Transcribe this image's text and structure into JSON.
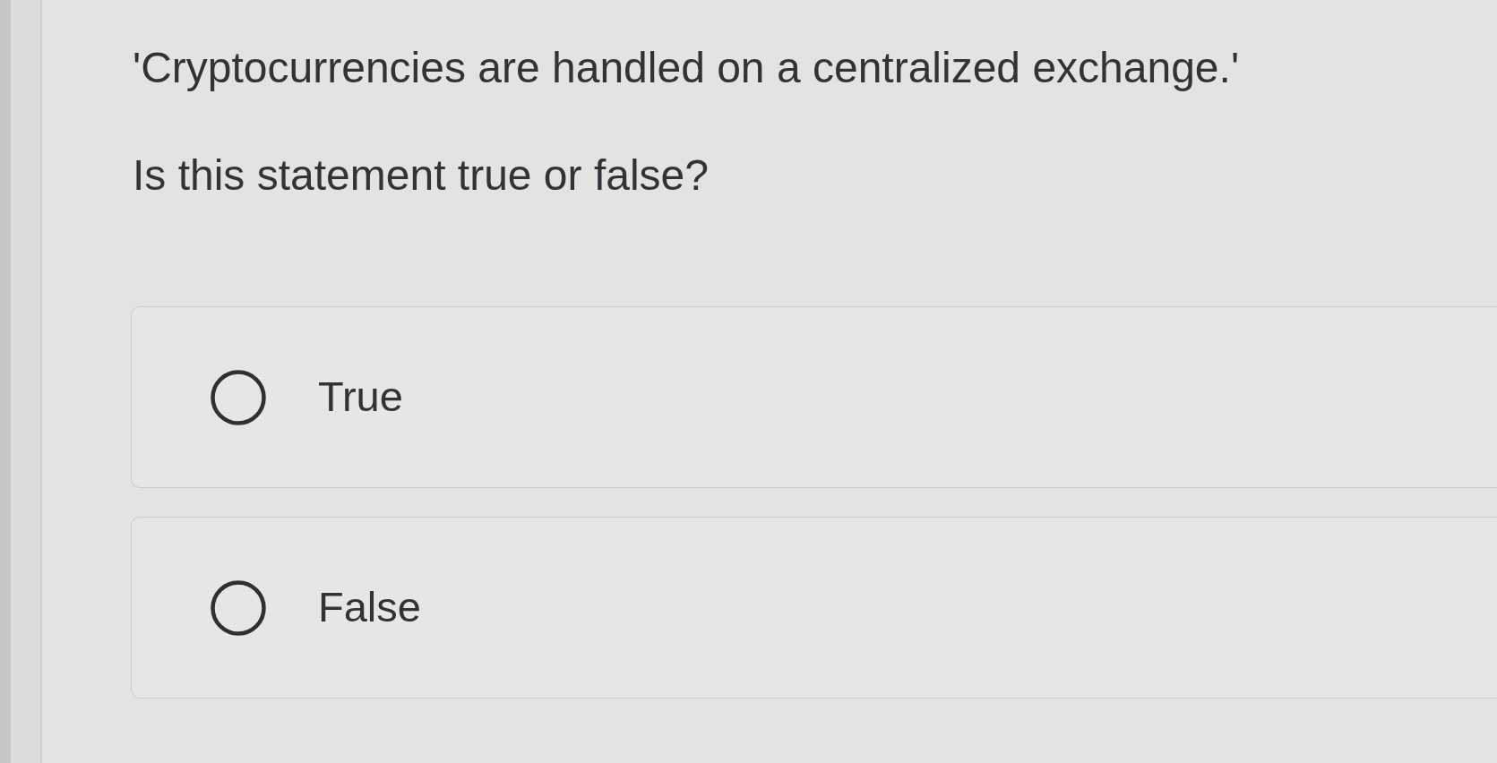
{
  "question": {
    "statement": "'Cryptocurrencies are handled on a centralized exchange.'",
    "prompt": "Is this statement true or false?"
  },
  "options": [
    {
      "label": "True",
      "selected": false
    },
    {
      "label": "False",
      "selected": false
    }
  ]
}
